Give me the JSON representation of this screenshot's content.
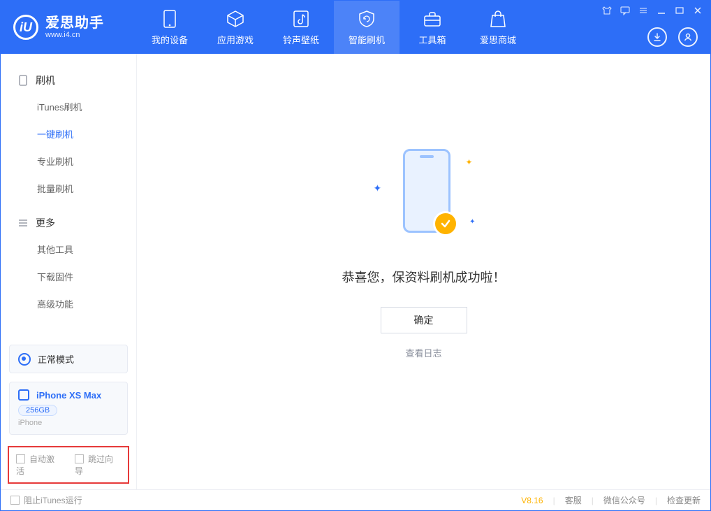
{
  "app": {
    "name_zh": "爱思助手",
    "name_en": "www.i4.cn"
  },
  "tabs": {
    "device": "我的设备",
    "apps": "应用游戏",
    "ringtones": "铃声壁纸",
    "flash": "智能刷机",
    "toolbox": "工具箱",
    "store": "爱思商城"
  },
  "sidebar": {
    "group_flash": "刷机",
    "group_more": "更多",
    "items": {
      "itunes": "iTunes刷机",
      "onekey": "一键刷机",
      "pro": "专业刷机",
      "batch": "批量刷机",
      "other": "其他工具",
      "firmware": "下载固件",
      "advanced": "高级功能"
    }
  },
  "device_panel": {
    "mode": "正常模式",
    "name": "iPhone XS Max",
    "storage": "256GB",
    "type": "iPhone"
  },
  "checkboxes": {
    "auto_activate": "自动激活",
    "skip_guide": "跳过向导"
  },
  "main": {
    "success": "恭喜您，保资料刷机成功啦！",
    "ok": "确定",
    "log": "查看日志"
  },
  "footer": {
    "block_itunes": "阻止iTunes运行",
    "version": "V8.16",
    "cs": "客服",
    "wechat": "微信公众号",
    "update": "检查更新"
  }
}
